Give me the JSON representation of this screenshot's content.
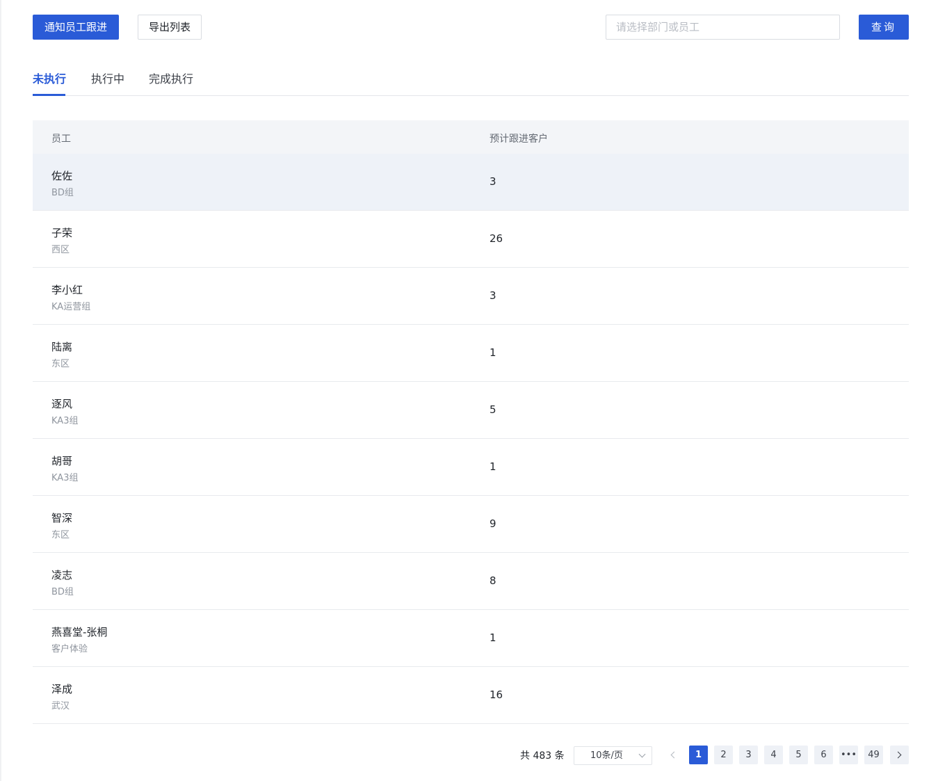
{
  "toolbar": {
    "notify_label": "通知员工跟进",
    "export_label": "导出列表",
    "search_placeholder": "请选择部门或员工",
    "search_value": "",
    "query_label": "查询"
  },
  "tabs": [
    {
      "label": "未执行",
      "active": true
    },
    {
      "label": "执行中",
      "active": false
    },
    {
      "label": "完成执行",
      "active": false
    }
  ],
  "table": {
    "columns": [
      "员工",
      "预计跟进客户"
    ],
    "rows": [
      {
        "name": "佐佐",
        "dept": "BD组",
        "count": "3"
      },
      {
        "name": "子荣",
        "dept": "西区",
        "count": "26"
      },
      {
        "name": "李小红",
        "dept": "KA运营组",
        "count": "3"
      },
      {
        "name": "陆离",
        "dept": "东区",
        "count": "1"
      },
      {
        "name": "逐风",
        "dept": "KA3组",
        "count": "5"
      },
      {
        "name": "胡哥",
        "dept": "KA3组",
        "count": "1"
      },
      {
        "name": "智深",
        "dept": "东区",
        "count": "9"
      },
      {
        "name": "凌志",
        "dept": "BD组",
        "count": "8"
      },
      {
        "name": "燕喜堂-张桐",
        "dept": "客户体验",
        "count": "1"
      },
      {
        "name": "泽成",
        "dept": "武汉",
        "count": "16"
      }
    ]
  },
  "pagination": {
    "total_text": "共 483 条",
    "page_size": "10条/页",
    "pages": [
      "1",
      "2",
      "3",
      "4",
      "5",
      "6",
      "•••",
      "49"
    ],
    "current": "1"
  },
  "colors": {
    "primary": "#2a5bd7",
    "header_bg": "#f3f5f8",
    "hover_row_bg": "#eef2f8"
  }
}
